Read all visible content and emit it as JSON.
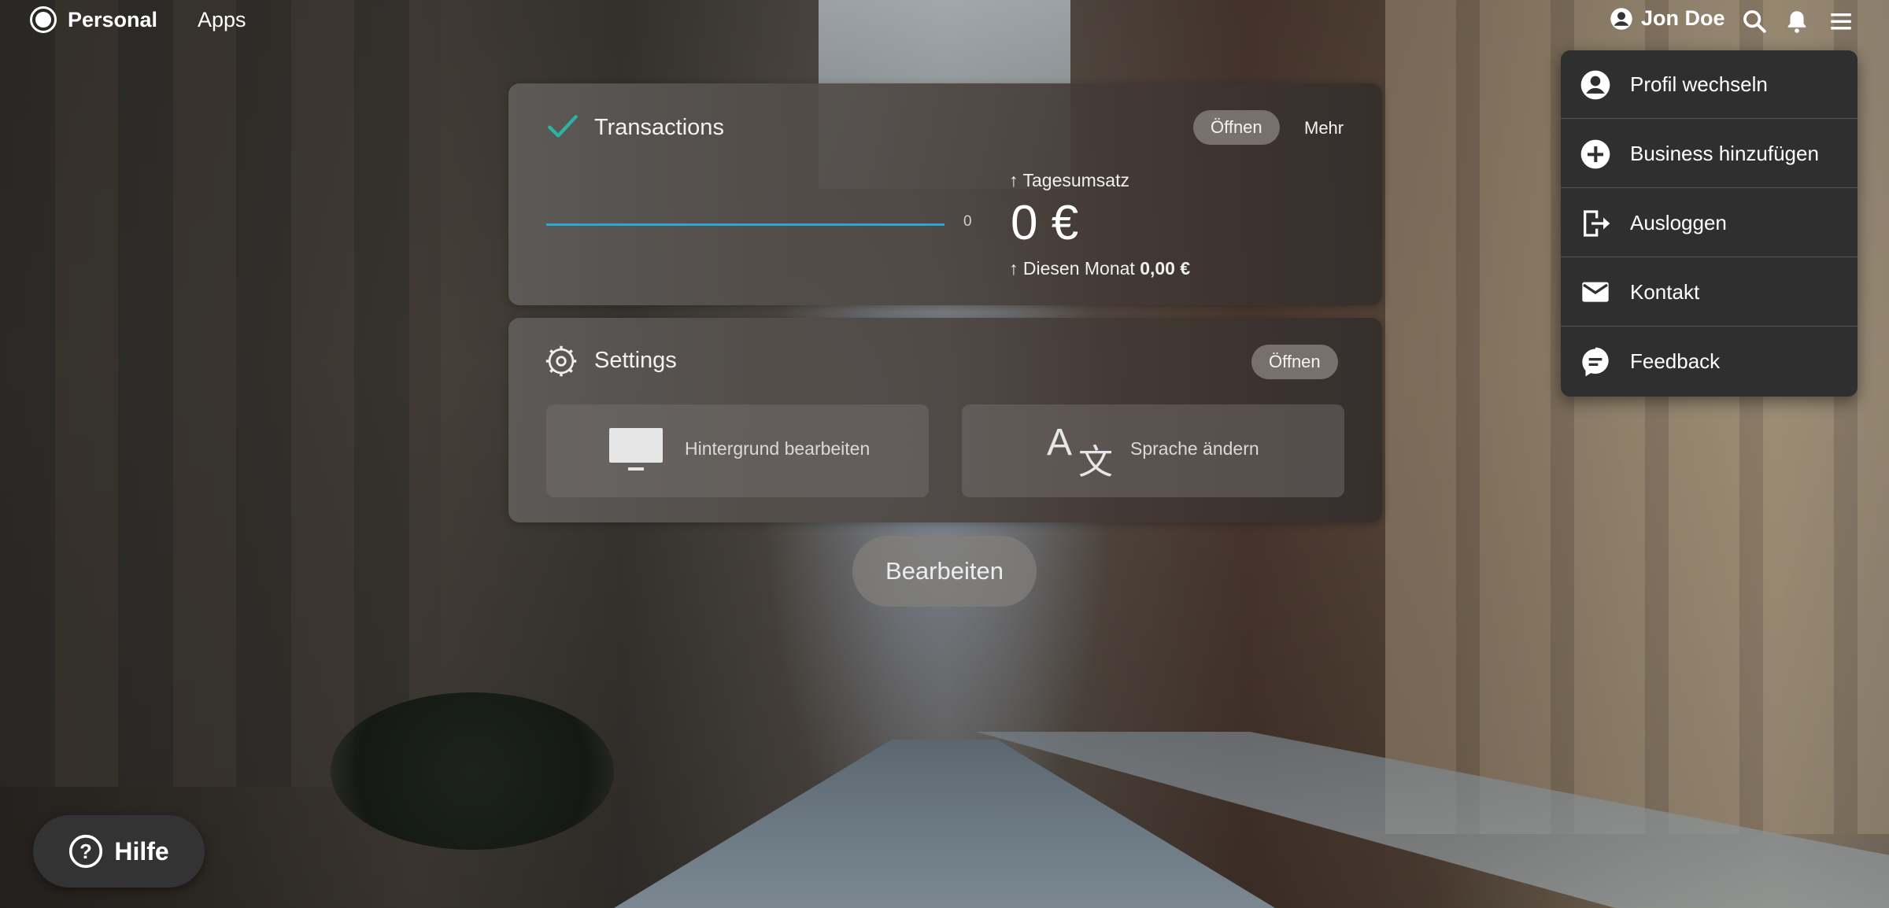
{
  "topbar": {
    "brand": "Personal",
    "apps": "Apps",
    "user_name": "Jon Doe"
  },
  "transactions": {
    "title": "Transactions",
    "open_label": "Öffnen",
    "more_label": "Mehr",
    "spark_value": "0",
    "kpi_label": "Tagesumsatz",
    "kpi_value": "0 €",
    "month_prefix": "Diesen Monat",
    "month_value": "0,00 €"
  },
  "settings": {
    "title": "Settings",
    "open_label": "Öffnen",
    "tiles": [
      {
        "label": "Hintergrund bearbeiten",
        "icon": "monitor-icon"
      },
      {
        "label": "Sprache ändern",
        "icon": "translate-icon"
      }
    ]
  },
  "menu": {
    "items": [
      {
        "label": "Profil wechseln",
        "icon": "account-switch-icon"
      },
      {
        "label": "Business hinzufügen",
        "icon": "add-circle-icon"
      },
      {
        "label": "Ausloggen",
        "icon": "logout-icon"
      },
      {
        "label": "Kontakt",
        "icon": "mail-icon"
      },
      {
        "label": "Feedback",
        "icon": "feedback-icon"
      }
    ]
  },
  "edit_label": "Bearbeiten",
  "help_label": "Hilfe",
  "colors": {
    "accent": "#2aa7d6",
    "check": "#2bb3a3",
    "menu_bg": "#2f2f2f"
  }
}
